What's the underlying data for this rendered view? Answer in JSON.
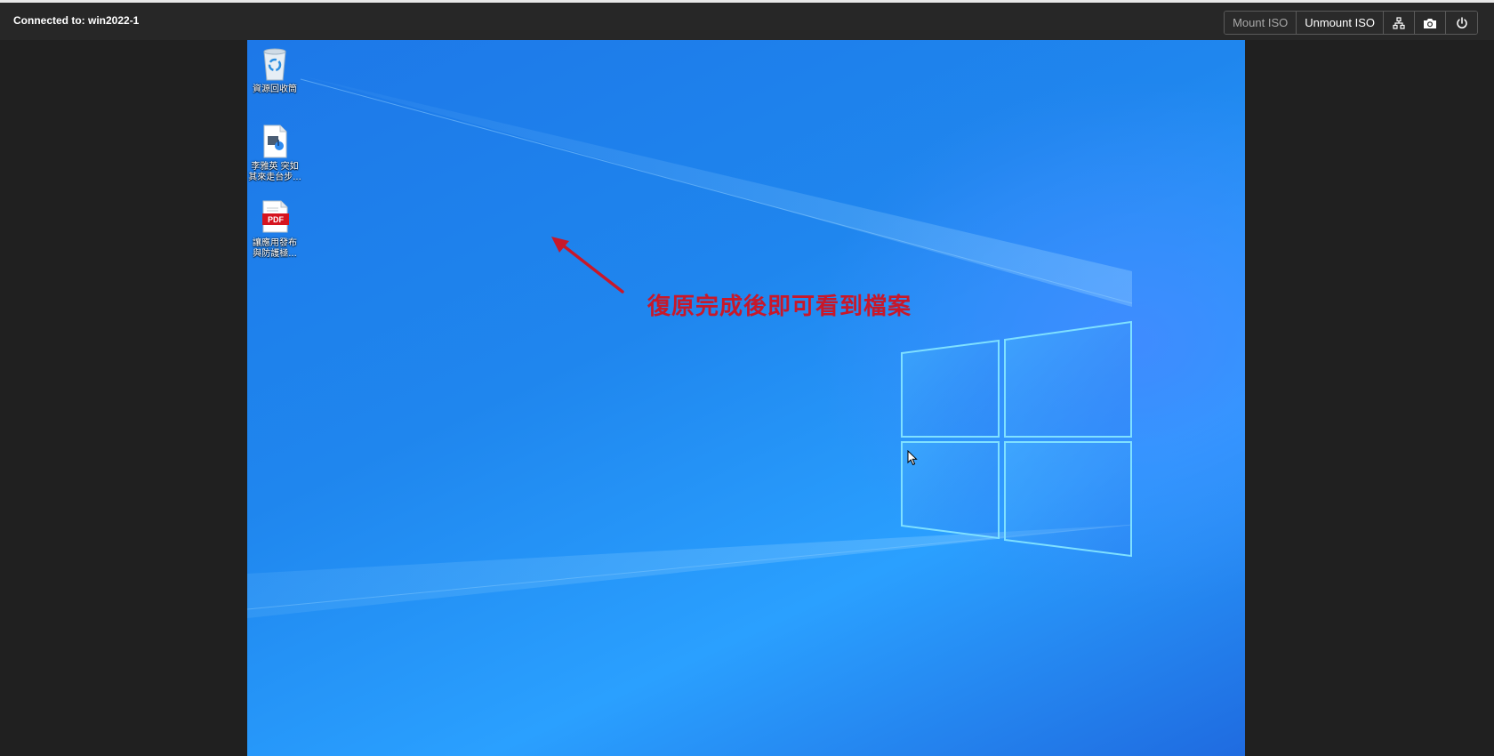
{
  "toolbar": {
    "connection_label": "Connected to: win2022-1",
    "mount_iso_label": "Mount ISO",
    "unmount_iso_label": "Unmount ISO",
    "icons": [
      "network-icon",
      "camera-icon",
      "power-icon"
    ]
  },
  "desktop": {
    "icons": [
      {
        "name": "recycle-bin-icon",
        "label": "資源回收筒"
      },
      {
        "name": "media-file-icon",
        "label_line1": "李雅英 突如",
        "label_line2": "其來走台步..."
      },
      {
        "name": "pdf-file-icon",
        "label_line1": "讓應用發布",
        "label_line2": "與防護極...",
        "badge": "PDF"
      }
    ]
  },
  "annotation": {
    "text": "復原完成後即可看到檔案",
    "color": "#c8182a"
  },
  "colors": {
    "toolbar_bg": "#272727",
    "page_bg": "#202020",
    "desktop_blue": "#1f86ee"
  }
}
